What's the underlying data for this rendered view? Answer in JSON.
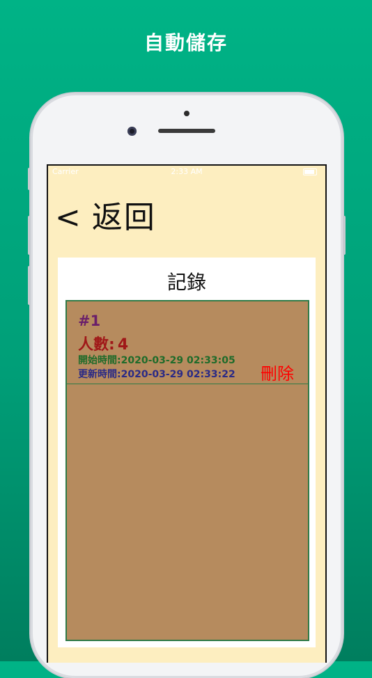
{
  "caption": "自動儲存",
  "status_bar": {
    "carrier": "Carrier",
    "time": "2:33 AM"
  },
  "nav": {
    "back_label": "返回",
    "back_chevron": "<"
  },
  "panel": {
    "title": "記錄"
  },
  "records": [
    {
      "id": "#1",
      "count_label": "人數:",
      "count_value": "4",
      "start_label": "開始時間:",
      "start_time": "2020-03-29 02:33:05",
      "update_label": "更新時間:",
      "update_time": "2020-03-29 02:33:22",
      "delete_label": "刪除"
    }
  ],
  "colors": {
    "background": "#00a47c",
    "screen": "#fdeec0",
    "list": "#b68b5e",
    "list_border": "#2f7a47",
    "delete": "#ff0000"
  }
}
